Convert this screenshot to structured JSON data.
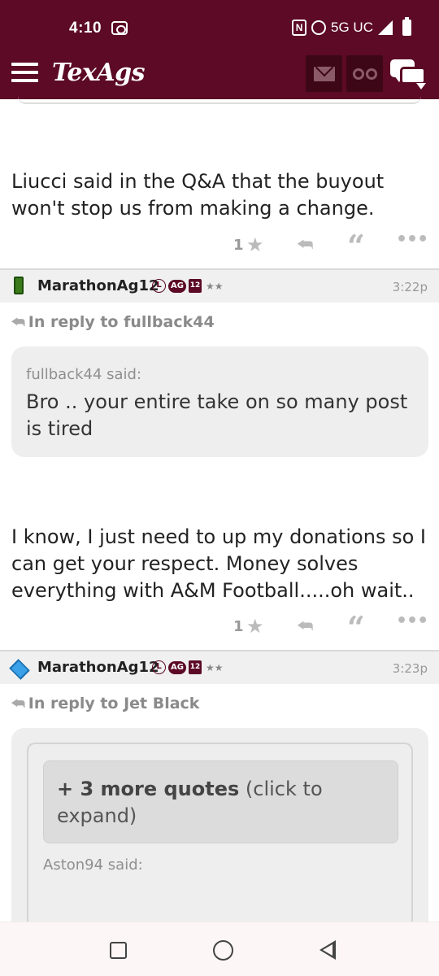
{
  "status_bar": {
    "time": "4:10",
    "network": "5G UC"
  },
  "app_bar": {
    "logo": "TexAgs"
  },
  "posts": [
    {
      "body": "Liucci said in the Q&A that the buyout won't stop us from making a change.",
      "star_count": "1"
    },
    {
      "username": "MarathonAg12",
      "badges": {
        "l": "L",
        "ag": "AG",
        "year": "12",
        "stars": "★★"
      },
      "time": "3:22p",
      "in_reply_to": "In reply to fullback44",
      "quote": {
        "said": "fullback44 said:",
        "text": "Bro .. your entire take on so many post is tired"
      },
      "body": "I know, I just need to up my donations so I can get your respect. Money solves everything with A&M Football.....oh wait..",
      "star_count": "1"
    },
    {
      "username": "MarathonAg12",
      "badges": {
        "l": "L",
        "ag": "AG",
        "year": "12",
        "stars": "★★"
      },
      "time": "3:23p",
      "in_reply_to": "In reply to Jet Black",
      "more_quotes_bold": "+ 3 more quotes",
      "more_quotes_rest": " (click to expand)",
      "quote_said": "Aston94 said:"
    }
  ],
  "icons": {
    "reply": "reply-icon",
    "quote": "quote-icon",
    "more": "more-icon",
    "star": "star-icon"
  }
}
